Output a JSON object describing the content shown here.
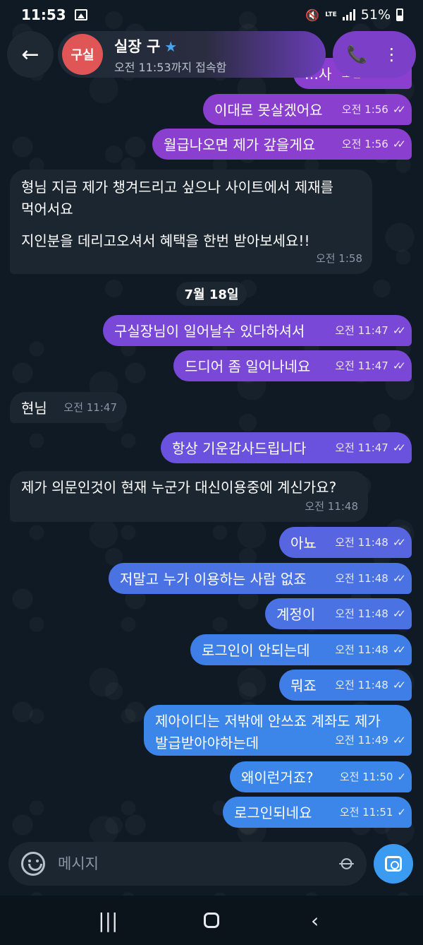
{
  "status_bar": {
    "time": "11:53",
    "network": "LTE",
    "battery": "51%"
  },
  "header": {
    "back_label": "←",
    "avatar_text": "구실",
    "contact_name": "실장 구",
    "last_seen": "오전 11:53까지 접속함",
    "call_label": "📞",
    "more_label": "⋮"
  },
  "chat": {
    "partial_top": {
      "text": "…사",
      "time": "오전 1:56"
    },
    "date_separator": "7월 18일",
    "messages": [
      {
        "dir": "out",
        "text": "이대로 못살겠어요",
        "time": "오전 1:56",
        "read": true
      },
      {
        "dir": "out",
        "text": "월급나오면 제가 갚을게요",
        "time": "오전 1:56",
        "read": true
      },
      {
        "dir": "in",
        "text": "형님 지금 제가 챙겨드리고 싶으나 사이트에서 제재를",
        "text2": "먹어서요",
        "text3": "지인분을 데리고오셔서 혜택을 한번 받아보세요!!",
        "time": "오전 1:58"
      },
      {
        "dir": "out",
        "text": "구실장님이 일어날수 있다하셔서",
        "time": "오전 11:47",
        "read": true
      },
      {
        "dir": "out",
        "text": "드디어 좀 일어나네요",
        "time": "오전 11:47",
        "read": true
      },
      {
        "dir": "in",
        "text": "현님",
        "time": "오전 11:47"
      },
      {
        "dir": "out",
        "text": "항상 기운감사드립니다",
        "time": "오전 11:47",
        "read": true
      },
      {
        "dir": "in",
        "text": "제가 의문인것이 현재 누군가 대신이용중에 계신가요?",
        "time": "오전 11:48"
      },
      {
        "dir": "out",
        "text": "아뇨",
        "time": "오전 11:48",
        "read": true
      },
      {
        "dir": "out",
        "text": "저말고 누가 이용하는 사람 없죠",
        "time": "오전 11:48",
        "read": true
      },
      {
        "dir": "out",
        "text": "계정이",
        "time": "오전 11:48",
        "read": true
      },
      {
        "dir": "out",
        "text": "로그인이 안되는데",
        "time": "오전 11:48",
        "read": true
      },
      {
        "dir": "out",
        "text": "뭐죠",
        "time": "오전 11:48",
        "read": true
      },
      {
        "dir": "out",
        "text": "제아이디는 저밖에 안쓰죠 계좌도 제가",
        "text2": "발급받아야하는데",
        "time": "오전 11:49",
        "read": true
      },
      {
        "dir": "out",
        "text": "왜이런거죠?",
        "time": "오전 11:50",
        "read": false
      },
      {
        "dir": "out",
        "text": "로그인되네요",
        "time": "오전 11:51",
        "read": false
      }
    ]
  },
  "input": {
    "placeholder": "메시지"
  },
  "nav": {
    "recents": "|||",
    "back": "‹"
  },
  "colors": {
    "background": "#0f1a24",
    "incoming": "#1c2631",
    "outgoing_top": "#8a3fce",
    "outgoing_bottom": "#3b86e8",
    "accent": "#3b9bf0"
  },
  "icons": [
    "back-arrow-icon",
    "star-icon",
    "phone-icon",
    "more-vertical-icon",
    "emoji-icon",
    "paperclip-icon",
    "camera-icon",
    "double-check-icon",
    "single-check-icon"
  ]
}
